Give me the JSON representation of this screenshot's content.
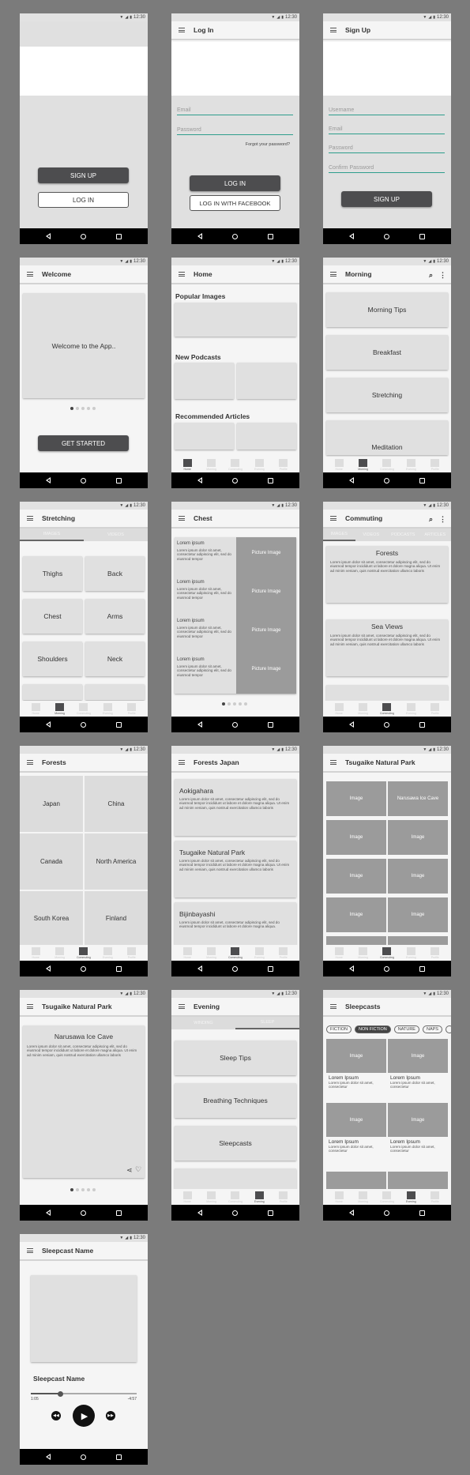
{
  "status": {
    "time": "12:30"
  },
  "screens": {
    "s1": {
      "signup_label": "SIGN UP",
      "login_label": "LOG IN"
    },
    "s2": {
      "title": "Log In",
      "email_ph": "Email",
      "password_ph": "Password",
      "forgot": "Forgot your password?",
      "login_label": "LOG IN",
      "fb_label": "LOG IN WITH FACEBOOK"
    },
    "s3": {
      "title": "Sign Up",
      "username_ph": "Username",
      "email_ph": "Email",
      "password_ph": "Password",
      "confirm_ph": "Confirm Password",
      "signup_label": "SIGN UP"
    },
    "s4": {
      "title": "Welcome",
      "card_text": "Welcome to the App..",
      "cta": "GET STARTED"
    },
    "s5": {
      "title": "Home",
      "popular": "Popular Images",
      "podcasts": "New Podcasts",
      "articles": "Recommended Articles"
    },
    "s6": {
      "title": "Morning",
      "items": [
        "Morning Tips",
        "Breakfast",
        "Stretching",
        "Meditation"
      ]
    },
    "s7": {
      "title": "Stretching",
      "tabs": [
        "IMAGES",
        "VIDEOS"
      ],
      "items": [
        "Thighs",
        "Back",
        "Chest",
        "Arms",
        "Shoulders",
        "Neck"
      ]
    },
    "s8": {
      "title": "Chest",
      "heading": "Lorem ipsum",
      "body": "Lorem ipsum dolor sit amet, consectetur adipiscing elit, sed do eiusmod tempor",
      "picture": "Picture Image"
    },
    "s9": {
      "title": "Commuting",
      "tabs": [
        "IMAGES",
        "VIDEOS",
        "PODCASTS",
        "ARTICLES"
      ],
      "cards": [
        {
          "title": "Forests",
          "body": "Lorem ipsum dolor sit amet, consectetur adipiscing elit, sed do eiusmod tempor incididunt ut labore et dolore magna aliqua. Ut enim ad minim veniam, quis nostrud exercitation ullamco laboris"
        },
        {
          "title": "Sea Views",
          "body": "Lorem ipsum dolor sit amet, consectetur adipiscing elit, sed do eiusmod tempor incididunt ut labore et dolore magna aliqua. Ut enim ad minim veniam, quis nostrud exercitation ullamco laboris"
        }
      ]
    },
    "s10": {
      "title": "Forests",
      "items": [
        "Japan",
        "China",
        "Canada",
        "North America",
        "South Korea",
        "Finland"
      ]
    },
    "s11": {
      "title": "Forests Japan",
      "cards": [
        {
          "title": "Aokigahara",
          "body": "Lorem ipsum dolor sit amet, consectetur adipiscing elit, sed do eiusmod tempor incididunt ut labore et dolore magna aliqua. Ut enim ad minim veniam, quis nostrud exercitation ullamco laboris"
        },
        {
          "title": "Tsugaike Natural Park",
          "body": "Lorem ipsum dolor sit amet, consectetur adipiscing elit, sed do eiusmod tempor incididunt ut labore et dolore magna aliqua. Ut enim ad minim veniam, quis nostrud exercitation ullamco laboris"
        },
        {
          "title": "Bijinbayashi",
          "body": "Lorem ipsum dolor sit amet, consectetur adipiscing elit, sed do eiusmod tempor incididunt ut labore et dolore magna aliqua."
        }
      ]
    },
    "s12": {
      "title": "Tsugaike Natural Park",
      "image": "Image",
      "featured": "Narusawa Ice Cave"
    },
    "s13": {
      "title": "Tsugaike Natural Park",
      "card_title": "Narusawa Ice Cave",
      "body": "Lorem ipsum dolor sit amet, consectetur adipiscing elit, sed do eiusmod tempor incididunt ut labore et dolore magna aliqua. Ut enim ad minim veniam, quis nostrud exercitation ullamco laboris"
    },
    "s14": {
      "title": "Evening",
      "tabs": [
        "WINDING",
        "SLEEP"
      ],
      "items": [
        "Sleep Tips",
        "Breathing Techniques",
        "Sleepcasts"
      ]
    },
    "s15": {
      "title": "Sleepcasts",
      "chips": [
        "FICTION",
        "NON FICTION",
        "NATURE",
        "NAPS"
      ],
      "image": "Image",
      "item_title": "Lorem Ipsum",
      "item_body": "Lorem ipsum dolor sit amet, consectetur"
    },
    "s16": {
      "title": "Sleepcast Name",
      "name": "Sleepcast Name",
      "elapsed": "1:05",
      "remaining": "-4:57",
      "progress": 0.28
    }
  },
  "bottom_nav": [
    "Home",
    "Morning",
    "Commuting",
    "Evening",
    "Profile"
  ]
}
